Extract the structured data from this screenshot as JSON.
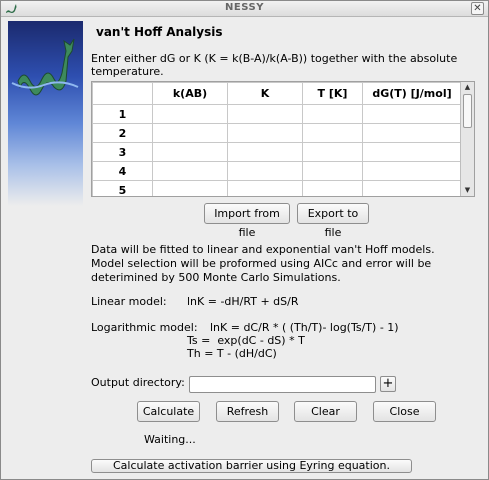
{
  "window": {
    "title": "NESSY",
    "close_glyph": "✕"
  },
  "heading": "van't Hoff Analysis",
  "instructions": "Enter either dG or K (K = k(B-A)/k(A-B)) together with the absolute temperature.",
  "table": {
    "columns": [
      "",
      "k(AB)",
      "K",
      "T [K]",
      "dG(T) [J/mol]"
    ],
    "rows": [
      "1",
      "2",
      "3",
      "4",
      "5"
    ]
  },
  "buttons": {
    "import": "Import from file",
    "export": "Export to file",
    "calculate": "Calculate",
    "refresh": "Refresh",
    "clear": "Clear",
    "close": "Close",
    "plus": "+",
    "activation": "Calculate activation barrier using Eyring equation."
  },
  "info": {
    "line1": "Data will be fitted to linear and exponential van't Hoff models.",
    "line2": "Model selection will be proformed using AICc and error will be",
    "line3": "deterimined by 500 Monte Carlo Simulations."
  },
  "models": {
    "linear_label": "Linear model:",
    "linear_eq": "lnK = -dH/RT + dS/R",
    "log_label": "Logarithmic model:",
    "log_eq1": "lnK = dC/R * ( (Th/T)- log(Ts/T) - 1)",
    "log_eq2": "Ts =  exp(dC - dS) * T",
    "log_eq3": "Th = T - (dH/dC)"
  },
  "output": {
    "label": "Output directory:",
    "value": ""
  },
  "status": "Waiting..."
}
